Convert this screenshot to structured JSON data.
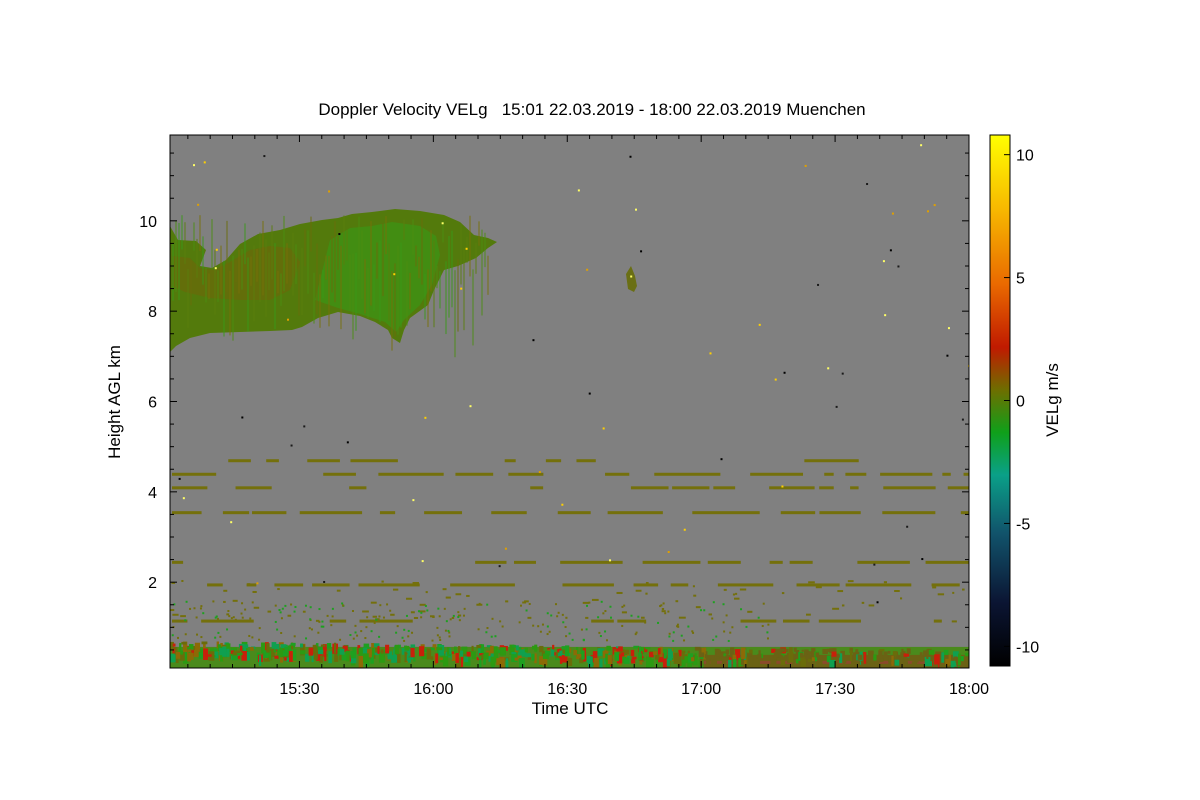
{
  "chart_data": {
    "type": "heatmap",
    "title": "Doppler Velocity VELg   15:01 22.03.2019 - 18:00 22.03.2019 Muenchen",
    "xlabel": "Time UTC",
    "ylabel": "Height AGL km",
    "x_range": [
      "15:01",
      "18:00"
    ],
    "ylim": [
      0.1,
      11.9
    ],
    "x_ticks": [
      "15:30",
      "16:00",
      "16:30",
      "17:00",
      "17:30",
      "18:00"
    ],
    "y_ticks": [
      2,
      4,
      6,
      8,
      10
    ],
    "background_color": "#808080",
    "colorbar": {
      "label": "VELg m/s",
      "range": [
        -10.8,
        10.8
      ],
      "ticks": [
        10,
        5,
        0,
        -5,
        -10
      ],
      "colors": [
        "#000000",
        "#0b1533",
        "#11536b",
        "#0aa088",
        "#0fa01a",
        "#6e6e00",
        "#c01a00",
        "#ea6a00",
        "#f7b800",
        "#ffff00"
      ]
    },
    "features": [
      {
        "name": "cirrus cloud",
        "t_start": "15:01",
        "t_end": "16:14",
        "base_km": 7.2,
        "top_km": 10.3,
        "velocity_ms": -1
      },
      {
        "name": "small cloud",
        "t_start": "16:44",
        "t_end": "16:46",
        "base_km": 8.5,
        "top_km": 9.1,
        "velocity_ms": -0.5
      },
      {
        "name": "boundary layer",
        "t_start": "15:01",
        "t_end": "18:00",
        "base_km": 0.1,
        "top_km": 0.7,
        "velocity_ms": -1
      },
      {
        "name": "aerosol layers",
        "heights_km": [
          4.7,
          4.4,
          4.1,
          3.55,
          2.45,
          1.95,
          1.15
        ],
        "velocity_ms": 0
      }
    ]
  }
}
